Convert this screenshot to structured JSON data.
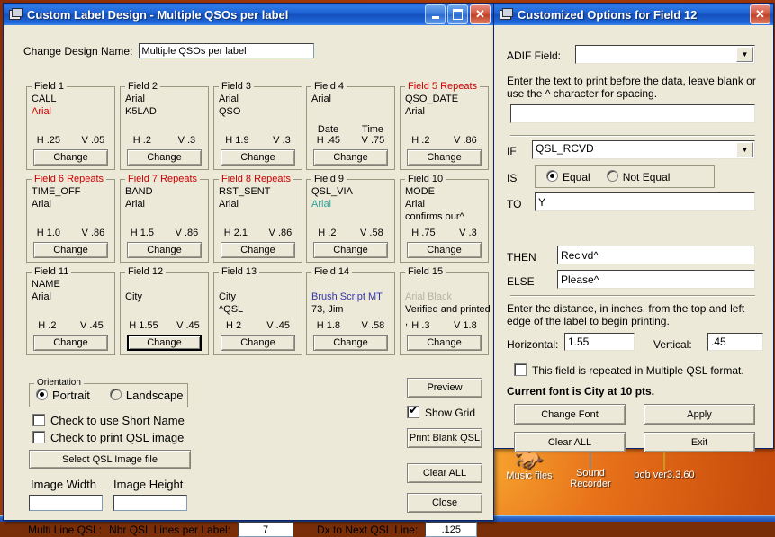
{
  "desktop": {
    "icons": [
      {
        "label": "Music files",
        "icon": "horse-shortcut-icon"
      },
      {
        "label": "Sound Recorder",
        "icon": "document-icon"
      },
      {
        "label": "bob ver3.3.60",
        "icon": "folder-icon"
      }
    ]
  },
  "main_window": {
    "title": "Custom Label Design - Multiple QSOs per label",
    "titlebar_icon": "window-app-icon",
    "buttons": {
      "minimize": "_",
      "maximize": "□",
      "close": "✕"
    },
    "design_name_label": "Change Design Name:",
    "design_name_value": "Multiple QSOs per label",
    "fields": [
      {
        "legend": "Field 1",
        "repeats": false,
        "line1": "CALL",
        "line2": "Arial",
        "line2_color": "#cc0000",
        "h": "H .25",
        "v": "V .05",
        "button": "Change",
        "focused": false
      },
      {
        "legend": "Field 2",
        "repeats": false,
        "line1": "Arial",
        "line2": "K5LAD",
        "line2_color": "#000000",
        "h": "H .2",
        "v": "V .3",
        "button": "Change",
        "focused": false
      },
      {
        "legend": "Field 3",
        "repeats": false,
        "line1": "Arial",
        "line2": "QSO",
        "line2_color": "#000000",
        "h": "H 1.9",
        "v": "V .3",
        "button": "Change",
        "focused": false
      },
      {
        "legend": "Field 4",
        "repeats": false,
        "line1": "Arial",
        "line2": "",
        "line2_color": "#000000",
        "h": "H .45",
        "v": "V .75",
        "sub_left": "Date",
        "sub_right": "Time",
        "button": "Change",
        "focused": false
      },
      {
        "legend": "Field 5 Repeats",
        "repeats": true,
        "line1": "QSO_DATE",
        "line2": "Arial",
        "line2_color": "#000000",
        "h": "H .2",
        "v": "V .86",
        "button": "Change",
        "focused": false
      },
      {
        "legend": "Field 6 Repeats",
        "repeats": true,
        "line1": "TIME_OFF",
        "line2": "Arial",
        "line2_color": "#000000",
        "h": "H 1.0",
        "v": "V .86",
        "button": "Change",
        "focused": false
      },
      {
        "legend": "Field 7 Repeats",
        "repeats": true,
        "line1": "BAND",
        "line2": "Arial",
        "line2_color": "#000000",
        "h": "H 1.5",
        "v": "V .86",
        "button": "Change",
        "focused": false
      },
      {
        "legend": "Field 8 Repeats",
        "repeats": true,
        "line1": "RST_SENT",
        "line2": "Arial",
        "line2_color": "#000000",
        "h": "H 2.1",
        "v": "V .86",
        "button": "Change",
        "focused": false
      },
      {
        "legend": "Field 9",
        "repeats": false,
        "line1": "QSL_VIA",
        "line2": "Arial",
        "line2_color": "#2aa79b",
        "h": "H .2",
        "v": "V .58",
        "button": "Change",
        "focused": false
      },
      {
        "legend": "Field 10",
        "repeats": false,
        "line1": "MODE",
        "line2": "Arial",
        "line2_color": "#000000",
        "line3": "confirms our^",
        "h": "H .75",
        "v": "V .3",
        "button": "Change",
        "focused": false
      },
      {
        "legend": "Field 11",
        "repeats": false,
        "line1": "NAME",
        "line2": "Arial",
        "line2_color": "#000000",
        "h": "H .2",
        "v": "V .45",
        "button": "Change",
        "focused": false
      },
      {
        "legend": "Field 12",
        "repeats": false,
        "line1": "",
        "line2": "City",
        "line2_color": "#000000",
        "h": "H 1.55",
        "v": "V .45",
        "button": "Change",
        "focused": true
      },
      {
        "legend": "Field 13",
        "repeats": false,
        "line1": "",
        "line2": "City",
        "line2_color": "#000000",
        "line3": "^QSL",
        "h": "H 2",
        "v": "V .45",
        "button": "Change",
        "focused": false
      },
      {
        "legend": "Field 14",
        "repeats": false,
        "line1": "",
        "line2": "Brush Script MT",
        "line2_color": "#3333aa",
        "line3": "73, Jim",
        "h": "H 1.8",
        "v": "V .58",
        "button": "Change",
        "focused": false
      },
      {
        "legend": "Field 15",
        "repeats": false,
        "line1": "",
        "line2": "Arial Black",
        "line2_color": "#b5b3a4",
        "line3": "Verified and printed",
        "line4": ",",
        "h": "H .3",
        "v": "V 1.8",
        "button": "Change",
        "focused": false
      }
    ],
    "orientation": {
      "legend": "Orientation",
      "options": [
        "Portrait",
        "Landscape"
      ],
      "selected": "Portrait"
    },
    "short_name_checkbox": {
      "label": "Check to use Short Name",
      "checked": false
    },
    "qsl_image_checkbox": {
      "label": "Check to print QSL image",
      "checked": false
    },
    "select_image_button": "Select QSL Image file",
    "image_width_label": "Image Width",
    "image_height_label": "Image Height",
    "image_width_value": "",
    "image_height_value": "",
    "multi_line_label": "Multi Line QSL:",
    "nbr_lines_label": "Nbr QSL Lines per Label:",
    "nbr_lines_value": "7",
    "dx_label": "Dx to Next QSL Line:",
    "dx_value": ".125",
    "right_buttons": {
      "preview": "Preview",
      "show_grid_label": "Show Grid",
      "show_grid_checked": true,
      "print_blank": "Print Blank QSL",
      "clear_all": "Clear ALL",
      "close": "Close"
    }
  },
  "options_window": {
    "title": "Customized Options for Field 12",
    "titlebar_icon": "window-app-icon",
    "close_button": "✕",
    "adif_label": "ADIF Field:",
    "adif_value": "",
    "prefix_help": "Enter the text to print before the data, leave blank or use the ^ character for spacing.",
    "prefix_value": "",
    "if_label": "IF",
    "if_value": "QSL_RCVD",
    "is_label": "IS",
    "is_options": [
      "Equal",
      "Not Equal"
    ],
    "is_selected": "Equal",
    "to_label": "TO",
    "to_value": "Y",
    "then_label": "THEN",
    "then_value": "Rec'vd^",
    "else_label": "ELSE",
    "else_value": "Please^",
    "distance_help": "Enter the distance, in inches, from the top and left edge of the label to begin printing.",
    "horizontal_label": "Horizontal:",
    "horizontal_value": "1.55",
    "vertical_label": "Vertical:",
    "vertical_value": ".45",
    "repeat_checkbox": {
      "label": "This field is repeated in Multiple QSL format.",
      "checked": false
    },
    "current_font": "Current font is City at 10 pts.",
    "buttons": {
      "change_font": "Change Font",
      "apply": "Apply",
      "clear_all": "Clear ALL",
      "exit": "Exit"
    }
  }
}
